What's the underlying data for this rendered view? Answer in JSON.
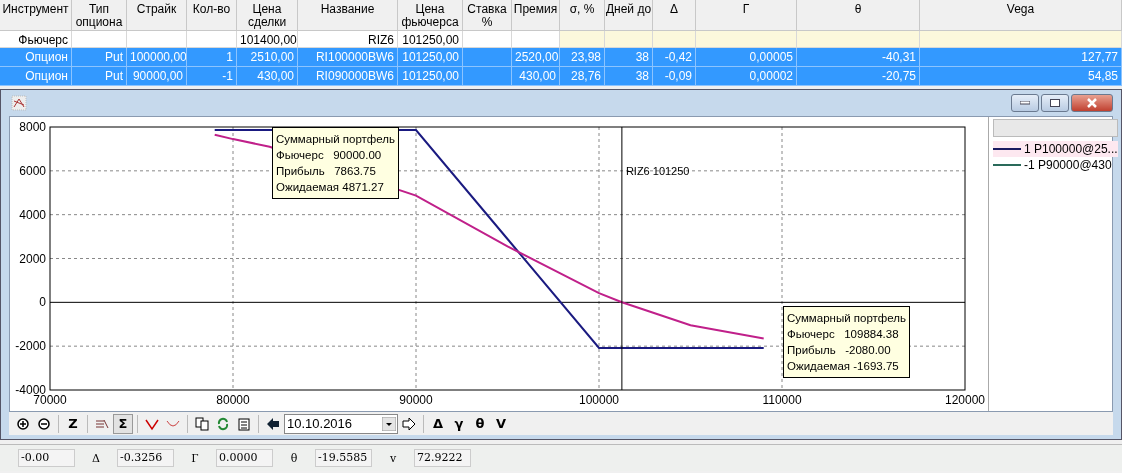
{
  "table": {
    "columns": [
      "Инструмент",
      "Тип опциона",
      "Страйк",
      "Кол-во",
      "Цена сделки",
      "Название",
      "Цена фьючерса",
      "Ставка %",
      "Премия",
      "σ, %",
      "Дней до",
      "Δ",
      "Г",
      "θ",
      "Vega"
    ],
    "rows": [
      {
        "selected": false,
        "cells": [
          "Фьючерс",
          null,
          null,
          null,
          "101400,00",
          "RIZ6",
          "101250,00",
          null,
          null,
          null,
          null,
          null,
          null,
          null,
          null
        ]
      },
      {
        "selected": true,
        "cells": [
          "Опцион",
          "Put",
          "100000,00",
          "1",
          "2510,00",
          "RI100000BW6",
          "101250,00",
          null,
          "2520,00",
          "23,98",
          "38",
          "-0,42",
          "0,00005",
          "-40,31",
          "127,77"
        ]
      },
      {
        "selected": true,
        "cells": [
          "Опцион",
          "Put",
          "90000,00",
          "-1",
          "430,00",
          "RI090000BW6",
          "101250,00",
          null,
          "430,00",
          "28,76",
          "38",
          "-0,09",
          "0,00002",
          "-20,75",
          "54,85"
        ]
      }
    ]
  },
  "chart_window": {
    "chart_data": {
      "type": "line",
      "x": [
        79000,
        80000,
        82000,
        90000,
        95000,
        100000,
        101250,
        105000,
        109000
      ],
      "series": [
        {
          "color": "#1a1a80",
          "values": [
            7860,
            7860,
            7860,
            7860,
            2890,
            -2080,
            -2080,
            -2080,
            -2080
          ]
        },
        {
          "color": "#c0208a",
          "values": [
            7650,
            7450,
            7100,
            4870,
            2550,
            420,
            0,
            -1050,
            -1650
          ]
        }
      ],
      "xlim": [
        70000,
        120000
      ],
      "ylim": [
        -4000,
        8000
      ],
      "xticks": [
        70000,
        80000,
        90000,
        100000,
        110000,
        120000
      ],
      "yticks": [
        -4000,
        -2000,
        0,
        2000,
        4000,
        6000,
        8000
      ],
      "grid": true,
      "ref_lines": [
        {
          "axis": "x",
          "value": 101250,
          "label": "RIZ6 101250"
        }
      ]
    },
    "tooltips": [
      {
        "title": "Суммарный портфель",
        "lines": [
          "Фьючерс   90000.00",
          "Прибыль   7863.75",
          "Ожидаемая 4871.27"
        ]
      },
      {
        "title": "Суммарный портфель",
        "lines": [
          "Фьючерс   109884.38",
          "Прибыль   -2080.00",
          "Ожидаемая -1693.75"
        ]
      }
    ],
    "legend": [
      {
        "label": "1 P100000@25...",
        "color": "#1a1a60",
        "selected": true
      },
      {
        "label": "-1 P90000@430",
        "color": "#2a6a5a",
        "selected": false
      }
    ],
    "toolbar": [
      {
        "kind": "zoom-in"
      },
      {
        "kind": "zoom-out"
      },
      {
        "kind": "sep"
      },
      {
        "kind": "text",
        "text": "Z",
        "pressed": false
      },
      {
        "kind": "sep"
      },
      {
        "kind": "lines"
      },
      {
        "kind": "text",
        "text": "Σ",
        "pressed": true
      },
      {
        "kind": "sep"
      },
      {
        "kind": "vee"
      },
      {
        "kind": "curve"
      },
      {
        "kind": "sep"
      },
      {
        "kind": "copy"
      },
      {
        "kind": "refresh"
      },
      {
        "kind": "calendar"
      },
      {
        "kind": "sep"
      },
      {
        "kind": "left"
      },
      {
        "kind": "date",
        "value": "10.10.2016"
      },
      {
        "kind": "right"
      },
      {
        "kind": "sep"
      },
      {
        "kind": "text",
        "text": "Δ",
        "pressed": false
      },
      {
        "kind": "text",
        "text": "γ",
        "pressed": false
      },
      {
        "kind": "text",
        "text": "θ",
        "pressed": false
      },
      {
        "kind": "text",
        "text": "V",
        "pressed": false
      }
    ]
  },
  "status_bar": [
    {
      "kind": "field",
      "text": "-0.00"
    },
    {
      "kind": "label",
      "text": "Δ"
    },
    {
      "kind": "field",
      "text": "-0.3256"
    },
    {
      "kind": "label",
      "text": "Г"
    },
    {
      "kind": "field",
      "text": "0.0000"
    },
    {
      "kind": "label",
      "text": "θ"
    },
    {
      "kind": "field",
      "text": "-19.5585"
    },
    {
      "kind": "label",
      "text": "v"
    },
    {
      "kind": "field",
      "text": "72.9222"
    }
  ]
}
